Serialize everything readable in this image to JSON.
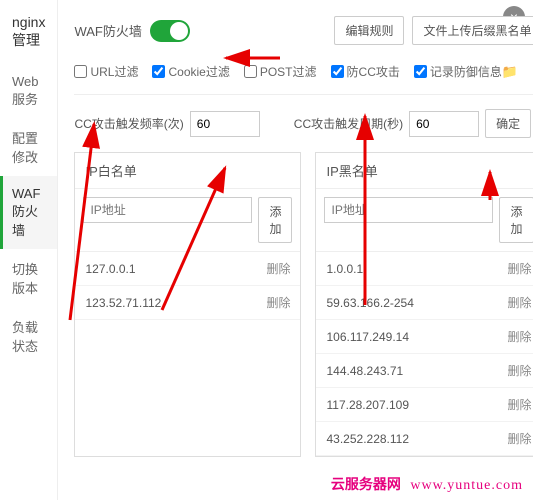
{
  "sidebar": {
    "title": "nginx管理",
    "items": [
      {
        "label": "Web服务"
      },
      {
        "label": "配置修改"
      },
      {
        "label": "WAF防火墙"
      },
      {
        "label": "切换版本"
      },
      {
        "label": "负载状态"
      }
    ],
    "active_index": 2
  },
  "header": {
    "waf_label": "WAF防火墙",
    "toggle_on": true,
    "edit_rules": "编辑规则",
    "upload_blacklist": "文件上传后缀黑名单"
  },
  "filters": {
    "url": {
      "label": "URL过滤",
      "checked": false
    },
    "cookie": {
      "label": "Cookie过滤",
      "checked": true
    },
    "post": {
      "label": "POST过滤",
      "checked": false
    },
    "cc": {
      "label": "防CC攻击",
      "checked": true
    },
    "log": {
      "label": "记录防御信息",
      "checked": true
    }
  },
  "cc": {
    "freq_label": "CC攻击触发频率(次)",
    "freq_value": "60",
    "cycle_label": "CC攻击触发周期(秒)",
    "cycle_value": "60",
    "confirm": "确定"
  },
  "whitelist": {
    "title": "IP白名单",
    "placeholder": "IP地址",
    "add": "添加",
    "delete": "删除",
    "items": [
      "127.0.0.1",
      "123.52.71.112"
    ]
  },
  "blacklist": {
    "title": "IP黑名单",
    "placeholder": "IP地址",
    "add": "添加",
    "delete": "删除",
    "items": [
      "1.0.0.1",
      "59.63.166.2-254",
      "106.117.249.14",
      "144.48.243.71",
      "117.28.207.109",
      "43.252.228.112"
    ]
  },
  "watermark": {
    "brand": "云服务器网",
    "url": "www.yuntue.com"
  }
}
